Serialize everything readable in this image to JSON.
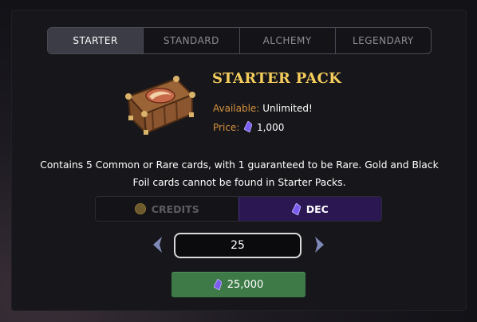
{
  "tabs": [
    {
      "label": "STARTER",
      "active": true
    },
    {
      "label": "STANDARD",
      "active": false
    },
    {
      "label": "ALCHEMY",
      "active": false
    },
    {
      "label": "LEGENDARY",
      "active": false
    }
  ],
  "pack": {
    "title": "STARTER PACK",
    "available_label": "Available:",
    "available_value": "Unlimited!",
    "price_label": "Price:",
    "price_value": "1,000",
    "description_line1": "Contains 5 Common or Rare cards, with 1 guaranteed to be Rare. Gold and Black",
    "description_line2": "Foil cards cannot be found in Starter Packs."
  },
  "currency": {
    "credits_label": "CREDITS",
    "dec_label": "DEC",
    "selected": "DEC"
  },
  "quantity": {
    "value": "25"
  },
  "buy_button": {
    "total": "25,000"
  },
  "colors": {
    "title": "#f3cc5c",
    "label_orange": "#d5913c",
    "dec_purple": "#2b1853",
    "buy_green": "#3e7a47"
  },
  "icons": {
    "price": "dec-crystal-icon",
    "credits": "coin-icon",
    "dec": "dec-crystal-icon",
    "prev": "chevron-left-icon",
    "next": "chevron-right-icon",
    "pack": "treasure-chest-icon"
  }
}
